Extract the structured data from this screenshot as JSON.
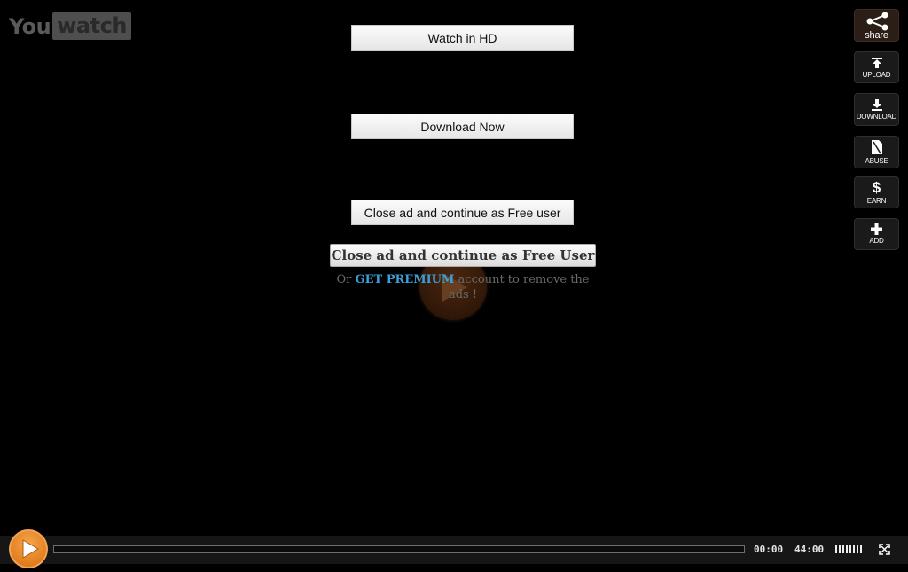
{
  "logo": {
    "part1": "You",
    "part2": "watch"
  },
  "ads": {
    "watch_hd": "Watch in HD",
    "download_now": "Download Now",
    "close_free": "Close ad and continue as Free user"
  },
  "overlay": {
    "close_button": "Close ad and continue as Free User",
    "premium_prefix": "Or ",
    "premium_link": "GET PREMIUM",
    "premium_suffix": " account to remove the ads !"
  },
  "sidebar": {
    "share": "share",
    "upload": "UPLOAD",
    "download": "DOWNLOAD",
    "abuse": "ABUSE",
    "earn": "EARN",
    "add": "ADD"
  },
  "player": {
    "current_time": "00:00",
    "duration": "44:00",
    "progress": 0,
    "volume_bars": 8
  },
  "colors": {
    "accent": "#e8862a",
    "premium_link": "#3aa0d8",
    "background": "#000000"
  },
  "icons": [
    "share-icon",
    "upload-icon",
    "download-icon",
    "abuse-icon",
    "dollar-icon",
    "plus-icon",
    "play-icon",
    "volume-icon",
    "fullscreen-icon"
  ]
}
